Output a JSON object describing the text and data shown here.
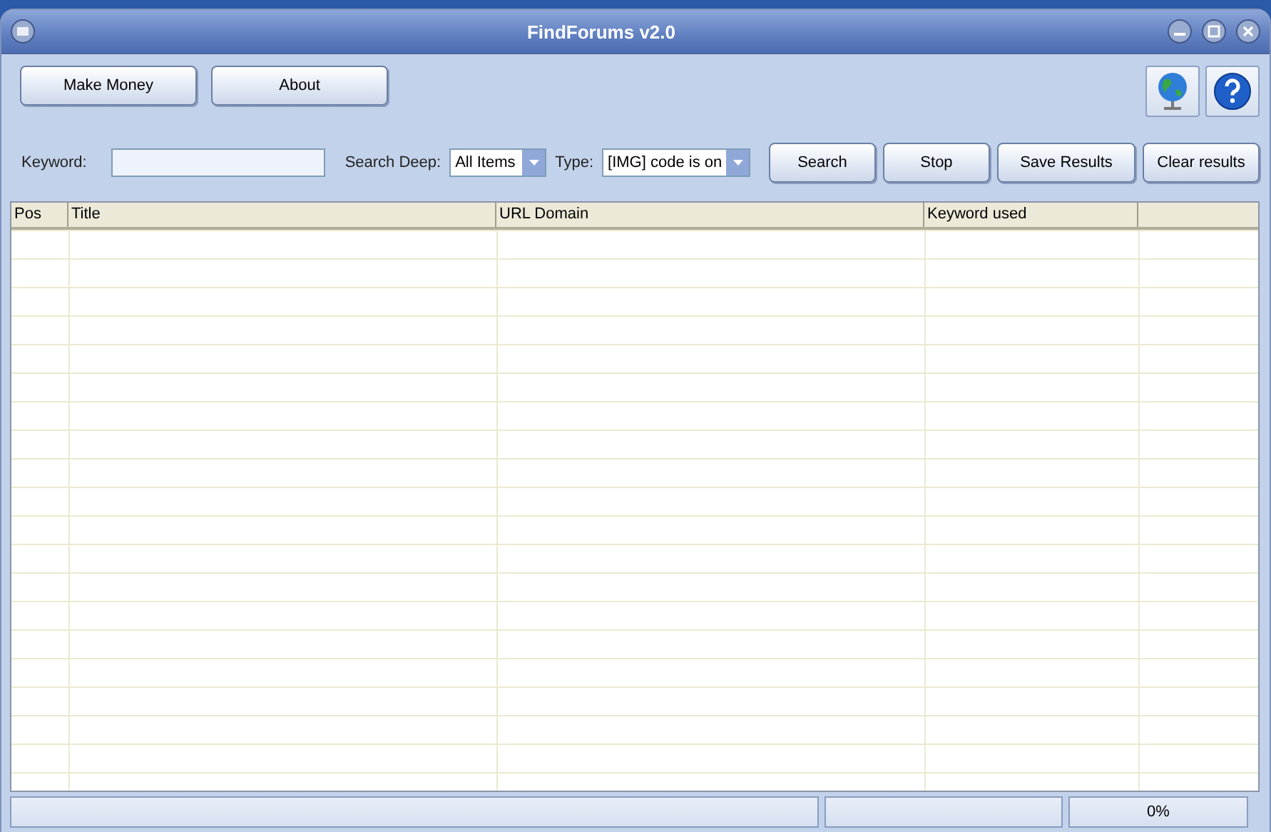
{
  "window": {
    "title": "FindForums v2.0"
  },
  "top_buttons": [
    "Make Money",
    "About"
  ],
  "search": {
    "keyword_label": "Keyword:",
    "deep_label": "Search Deep:",
    "deep_value": "All Items",
    "type_label": "Type:",
    "type_value": "[IMG] code is on"
  },
  "action_buttons": [
    "Search",
    "Stop",
    "Save Results",
    "Clear results"
  ],
  "table": {
    "columns": [
      "Pos",
      "Title",
      "URL Domain",
      "Keyword used"
    ]
  },
  "status_bar": {
    "progress_text": "0%"
  }
}
